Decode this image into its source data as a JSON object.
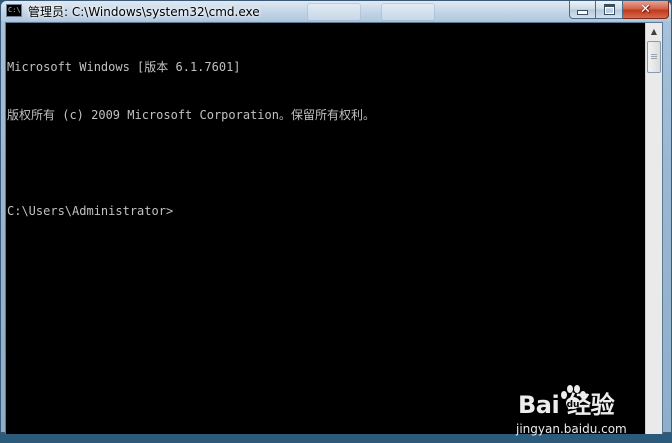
{
  "window": {
    "title": "管理员: C:\\Windows\\system32\\cmd.exe",
    "icon": "cmd-icon",
    "icon_text": "C:\\",
    "background_tabs": [
      "",
      ""
    ],
    "controls": {
      "minimize": "minimize-icon",
      "maximize": "maximize-icon",
      "close": "close-icon",
      "close_glyph": "✕"
    },
    "colors": {
      "console_background": "#000000",
      "console_text": "#c0c0c0",
      "close_button": "#c8452b"
    }
  },
  "console": {
    "lines": [
      "Microsoft Windows [版本 6.1.7601]",
      "版权所有 (c) 2009 Microsoft Corporation。保留所有权利。",
      "",
      "C:\\Users\\Administrator>"
    ]
  },
  "scrollbar": {
    "up_arrow": "▲",
    "position": 0
  },
  "watermark": {
    "brand": "Bai  经验",
    "paw_icon": "paw-icon",
    "url": "jingyan.baidu.com"
  }
}
